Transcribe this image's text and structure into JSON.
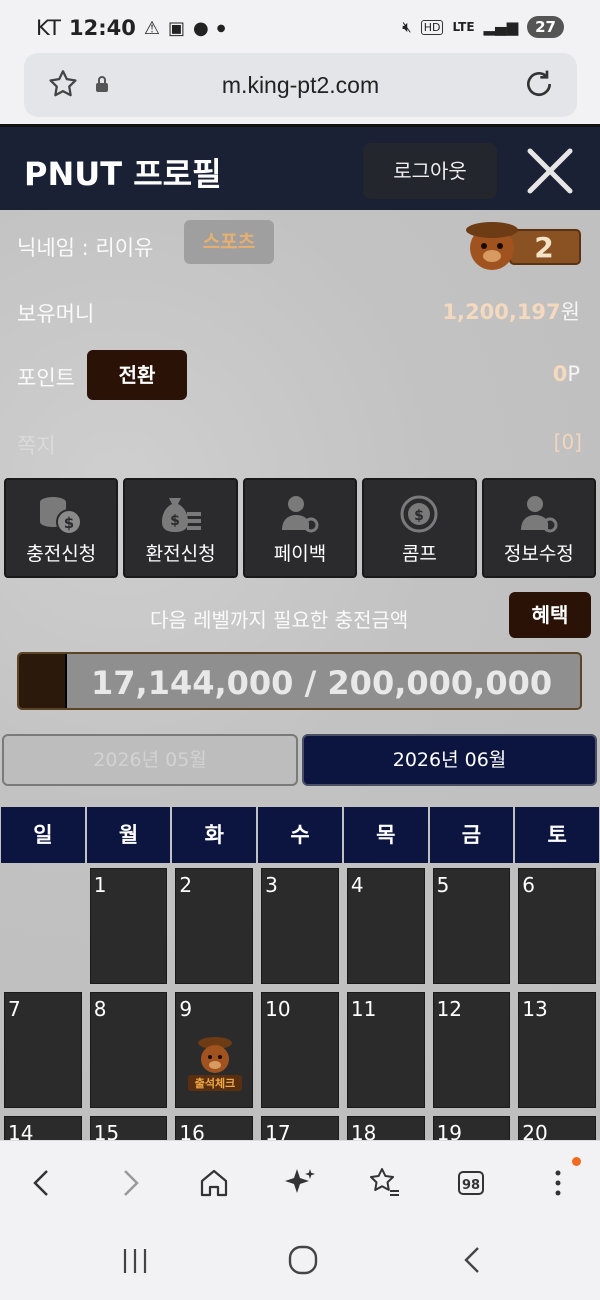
{
  "status_bar": {
    "carrier": "KT",
    "time": "12:40",
    "network": "LTE",
    "battery": "27"
  },
  "browser": {
    "url": "m.king-pt2.com",
    "tabs_count": "98"
  },
  "header": {
    "title": "PNUT 프로필",
    "logout_label": "로그아웃"
  },
  "profile": {
    "nickname_label": "닉네임 : 리이유",
    "badge": "스포츠",
    "level": "2",
    "money_label": "보유머니",
    "money_value": "1,200,197",
    "money_unit": "원",
    "point_label": "포인트",
    "convert_label": "전환",
    "point_value": "0",
    "point_unit": "P",
    "message_label": "쪽지",
    "message_value": "[0]"
  },
  "actions": [
    {
      "label": "충전신청",
      "icon": "coins-icon"
    },
    {
      "label": "환전신청",
      "icon": "money-bag-icon"
    },
    {
      "label": "페이백",
      "icon": "user-gear-icon"
    },
    {
      "label": "콤프",
      "icon": "coin-refresh-icon"
    },
    {
      "label": "정보수정",
      "icon": "user-gear-icon"
    }
  ],
  "level_progress": {
    "caption": "다음 레벨까지 필요한 충전금액",
    "benefit_label": "혜택",
    "text": "17,144,000 / 200,000,000",
    "current": 17144000,
    "target": 200000000
  },
  "calendar": {
    "prev_month": "2026년 05월",
    "current_month": "2026년 06월",
    "weekdays": [
      "일",
      "월",
      "화",
      "수",
      "목",
      "금",
      "토"
    ],
    "days": [
      "",
      "1",
      "2",
      "3",
      "4",
      "5",
      "6",
      "7",
      "8",
      "9",
      "10",
      "11",
      "12",
      "13",
      "14",
      "15",
      "16",
      "17",
      "18",
      "19",
      "20"
    ],
    "stamped_day": "9",
    "stamp_text": "출석체크"
  },
  "colors": {
    "header_bg": "#1b2135",
    "calendar_header_bg": "#0b1540",
    "accent_brown": "#2a1207"
  }
}
